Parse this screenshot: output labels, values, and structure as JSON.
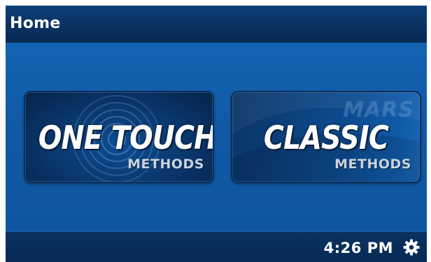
{
  "header": {
    "title": "Home"
  },
  "tiles": [
    {
      "main_label": "ONE TOUCH",
      "sub_label": "METHODS"
    },
    {
      "main_label": "CLASSIC",
      "sub_label": "METHODS",
      "watermark": "MARS"
    }
  ],
  "footer": {
    "time": "4:26 PM",
    "settings_icon": "gear-icon"
  },
  "colors": {
    "background": "#115aa6",
    "bar": "#0a3262",
    "text": "#ffffff",
    "sub_text": "#c9d3de"
  }
}
